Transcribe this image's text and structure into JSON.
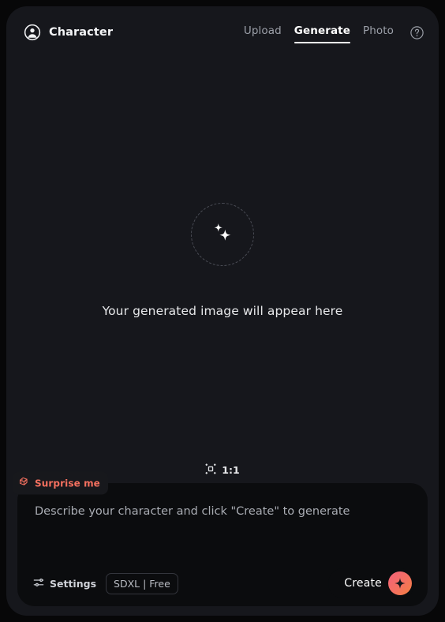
{
  "app": {
    "brand_label": "Character",
    "brand_icon": "user-circle-icon"
  },
  "nav": {
    "tabs": [
      {
        "label": "Upload",
        "active": false
      },
      {
        "label": "Generate",
        "active": true
      },
      {
        "label": "Photo",
        "active": false
      }
    ],
    "help_icon": "question-circle-icon"
  },
  "canvas": {
    "placeholder_icon": "sparkles-icon",
    "placeholder_text": "Your generated image will appear here"
  },
  "aspect": {
    "icon": "crop-frame-icon",
    "label": "1:1"
  },
  "prompt": {
    "surprise": {
      "icon": "dice-icon",
      "label": "Surprise me"
    },
    "value": "",
    "placeholder": "Describe your character and click \"Create\" to generate"
  },
  "footer": {
    "settings_icon": "sliders-icon",
    "settings_label": "Settings",
    "model_label": "SDXL | Free",
    "create_label": "Create",
    "create_icon": "sparkle-star-icon"
  },
  "colors": {
    "page_background": "#070708",
    "panel_background": "#16171c",
    "card_background": "#0b0c0e",
    "accent_coral": "#f4705f",
    "accent_pink": "#f2617a",
    "accent_orange": "#f5803f",
    "text_primary": "#ffffff",
    "text_muted": "#9ca0a9"
  }
}
